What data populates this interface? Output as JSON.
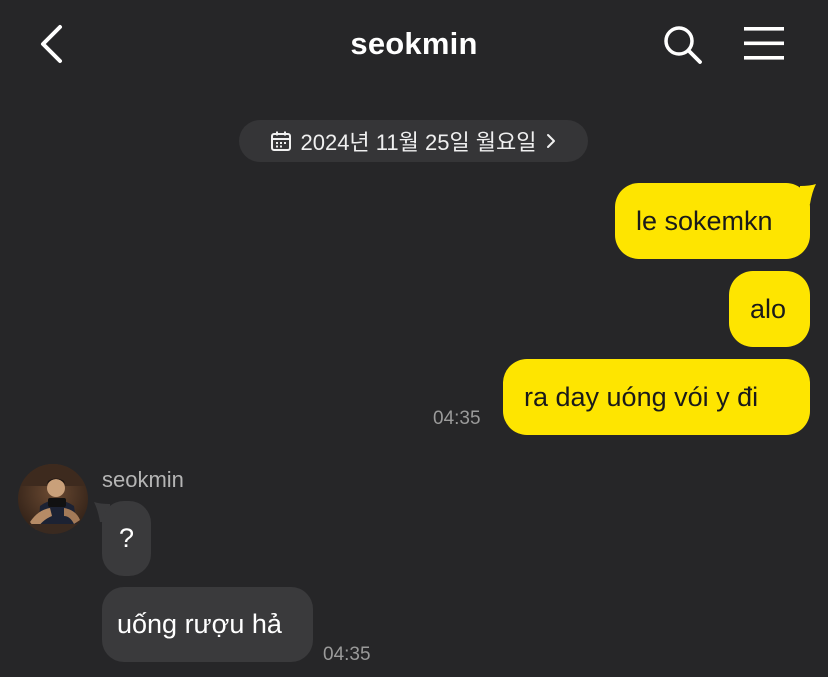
{
  "header": {
    "title": "seokmin",
    "back_icon": "chevron-left-icon",
    "search_icon": "search-icon",
    "menu_icon": "hamburger-menu-icon"
  },
  "date_divider": {
    "text": "2024년 11월 25일 월요일",
    "icon": "calendar-icon",
    "chevron": "chevron-right-icon"
  },
  "messages_sent": [
    {
      "text": "le sokemkn"
    },
    {
      "text": "alo"
    },
    {
      "text": "ra day uóng vói y đi",
      "time": "04:35"
    }
  ],
  "messages_received": {
    "sender": "seokmin",
    "avatar_icon": "profile-photo",
    "items": [
      {
        "text": "?"
      },
      {
        "text": "uống rượu hả",
        "time": "04:35"
      }
    ]
  },
  "colors": {
    "background": "#262628",
    "sent_bubble": "#fee500",
    "received_bubble": "#3a3a3c",
    "date_pill": "#353537"
  }
}
